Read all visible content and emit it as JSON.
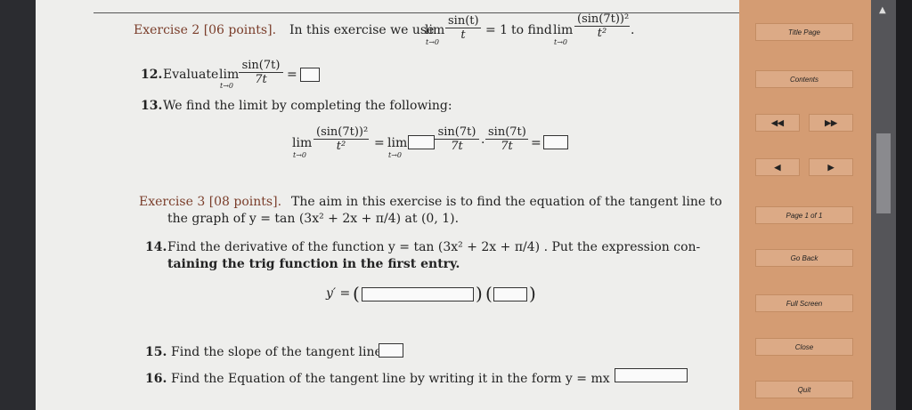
{
  "ex2": {
    "title": "Exercise 2 [06 points].",
    "text_a": "In this exercise we use",
    "lim": "lim",
    "t_to_0": "t→0",
    "sin_t": "sin(t)",
    "t": "t",
    "eq_1": "= 1",
    "to_find": "to find",
    "sin7t_sq": "(sin(7t))²",
    "t_sq": "t²",
    "period": "."
  },
  "q12": {
    "label": "12.",
    "text": "Evaluate",
    "num": "sin(7t)",
    "den": "7t",
    "eq": "="
  },
  "q13": {
    "label": "13.",
    "text": "We find the limit by completing the following:",
    "num1": "(sin(7t))²",
    "den1": "t²",
    "eq": "=",
    "num2": "sin(7t)",
    "den2": "7t",
    "num3": "sin(7t)",
    "den3": "7t",
    "dot": "·"
  },
  "ex3": {
    "title": "Exercise 3 [08 points].",
    "line1": "The aim in this exercise is to find the equation of the tangent line to",
    "line2": "the graph of y = tan (3x² + 2x + π/4) at (0, 1)."
  },
  "q14": {
    "label": "14.",
    "line1": "Find the derivative of the function y = tan (3x² + 2x + π/4) . Put the expression con-",
    "line2": "taining the trig function in the first entry.",
    "yprime": "y′ ="
  },
  "q15": {
    "label": "15.",
    "text": "Find the slope of the tangent line."
  },
  "q16": {
    "label": "16.",
    "text": "Find the Equation of the tangent line by writing it in the form y = mx + b."
  },
  "nav": {
    "title_page": "Title Page",
    "contents": "Contents",
    "first": "◀◀",
    "last": "▶▶",
    "prev": "◀",
    "next": "▶",
    "page_of": "Page 1 of 1",
    "go_back": "Go Back",
    "full_screen": "Full Screen",
    "close": "Close",
    "quit": "Quit"
  }
}
